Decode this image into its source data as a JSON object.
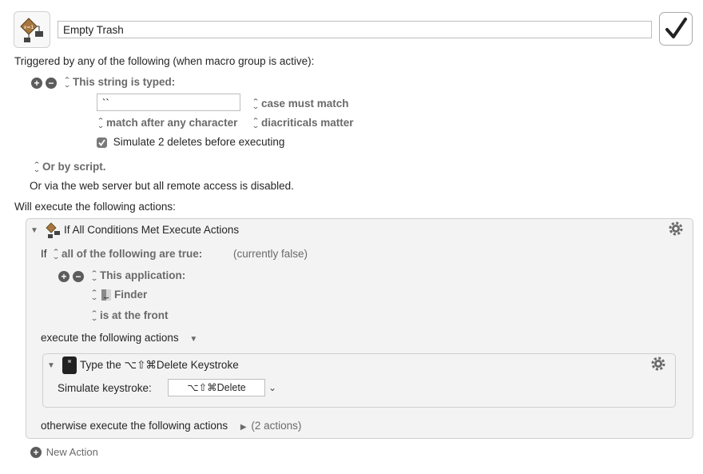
{
  "macro": {
    "name": "Empty Trash",
    "enabled": true
  },
  "trigger": {
    "heading": "Triggered by any of the following (when macro group is active):",
    "type_label": "This string is typed:",
    "typed_string": "``",
    "case_option": "case must match",
    "match_option": "match after any character",
    "diacriticals_option": "diacriticals matter",
    "simulate_deletes_label": "Simulate 2 deletes before executing",
    "simulate_deletes_checked": true,
    "script_label": "Or by script.",
    "web_server_text": "Or via the web server but all remote access is disabled."
  },
  "actions": {
    "heading": "Will execute the following actions:",
    "if_block": {
      "title": "If All Conditions Met Execute Actions",
      "if_word": "If",
      "condition_mode": "all of the following are true:",
      "current_state": "(currently false)",
      "condition_type": "This application:",
      "application": "Finder",
      "app_state": "is at the front",
      "execute_label": "execute the following actions",
      "type_action": {
        "title": "Type the ⌥⇧⌘Delete Keystroke",
        "simulate_label": "Simulate keystroke:",
        "keystroke": "⌥⇧⌘Delete"
      },
      "otherwise_label": "otherwise execute the following actions",
      "otherwise_count": "(2 actions)"
    },
    "new_action_label": "New Action"
  },
  "colors": {
    "panel_bg": "#f3f3f3",
    "panel_border": "#cfcfcf",
    "control_gray": "#5c5c5c"
  }
}
